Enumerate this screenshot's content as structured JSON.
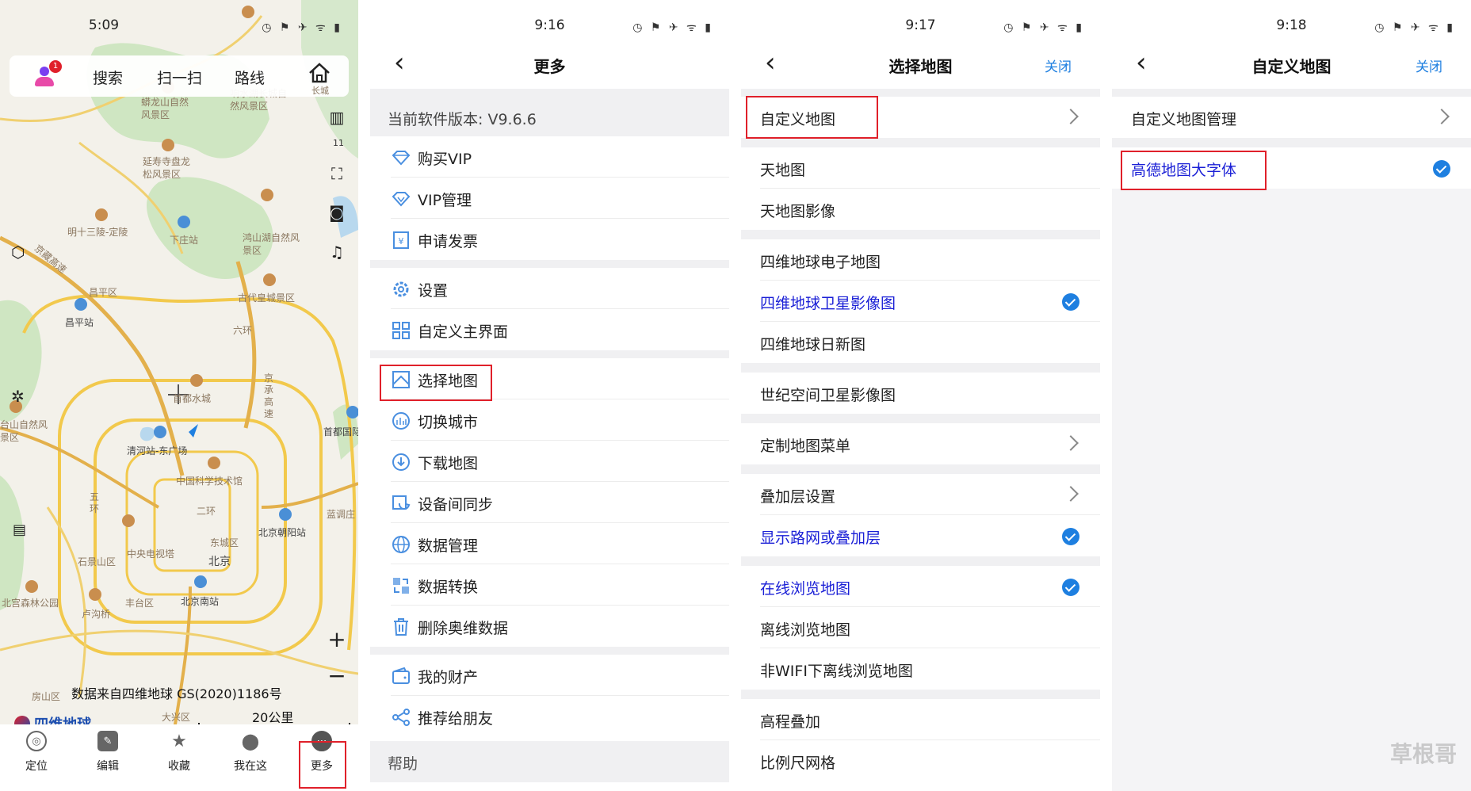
{
  "screen1": {
    "status_time": "5:09",
    "status_icons": "◷ ⚑ ✈ ᯤ ▮",
    "badge_count": "1",
    "top_actions": [
      "搜索",
      "扫一扫",
      "路线"
    ],
    "home_label": "长城",
    "side_map_count": "11",
    "map_labels": [
      "蟒龙山自然风景区",
      "响水湖长城自然风景区",
      "延寿寺盘龙松风景区",
      "明十三陵-定陵",
      "下庄站",
      "鸿山湖自然风景区",
      "京藏高速",
      "昌平区",
      "古代皇城景区",
      "昌平站",
      "六环",
      "京承高速",
      "首都水城",
      "首都国际",
      "台山自然风景区",
      "清河站-东广场",
      "中国科学技术馆",
      "二环",
      "五环",
      "北京朝阳站",
      "蓝调庄",
      "石景山区",
      "中央电视塔",
      "东城区",
      "北京",
      "北宫森林公园",
      "丰台区",
      "北京南站",
      "卢沟桥",
      "房山区",
      "大兴区"
    ],
    "attribution": "数据来自四维地球 GS(2020)1186号",
    "brand": "四维地球",
    "scale": "20公里",
    "bottom_nav": [
      "定位",
      "编辑",
      "收藏",
      "我在这",
      "更多"
    ]
  },
  "screen2": {
    "status_time": "9:16",
    "status_icons": "◷ ⚑ ✈ ᯤ ▮",
    "title": "更多",
    "version": "当前软件版本: V9.6.6",
    "group1": [
      "购买VIP",
      "VIP管理",
      "申请发票"
    ],
    "group2": [
      "设置",
      "自定义主界面"
    ],
    "group3": [
      "选择地图",
      "切换城市",
      "下载地图",
      "设备间同步",
      "数据管理",
      "数据转换",
      "删除奥维数据"
    ],
    "group4": [
      "我的财产",
      "推荐给朋友"
    ],
    "help": "帮助"
  },
  "screen3": {
    "status_time": "9:17",
    "status_icons": "◷ ⚑ ✈ ᯤ ▮",
    "title": "选择地图",
    "close": "关闭",
    "rows": [
      "自定义地图",
      "天地图",
      "天地图影像",
      "四维地球电子地图",
      "四维地球卫星影像图",
      "四维地球日新图",
      "世纪空间卫星影像图",
      "定制地图菜单",
      "叠加层设置",
      "显示路网或叠加层",
      "在线浏览地图",
      "离线浏览地图",
      "非WIFI下离线浏览地图",
      "高程叠加",
      "比例尺网格"
    ]
  },
  "screen4": {
    "status_time": "9:18",
    "status_icons": "◷ ⚑ ✈ ᯤ ▮",
    "title": "自定义地图",
    "close": "关闭",
    "rows": [
      "自定义地图管理",
      "高德地图大字体"
    ]
  },
  "watermark": "草根哥",
  "colors": {
    "accent": "#1e7fe0",
    "highlight_red": "#e0202a",
    "selected_text": "#1a1fd6"
  }
}
